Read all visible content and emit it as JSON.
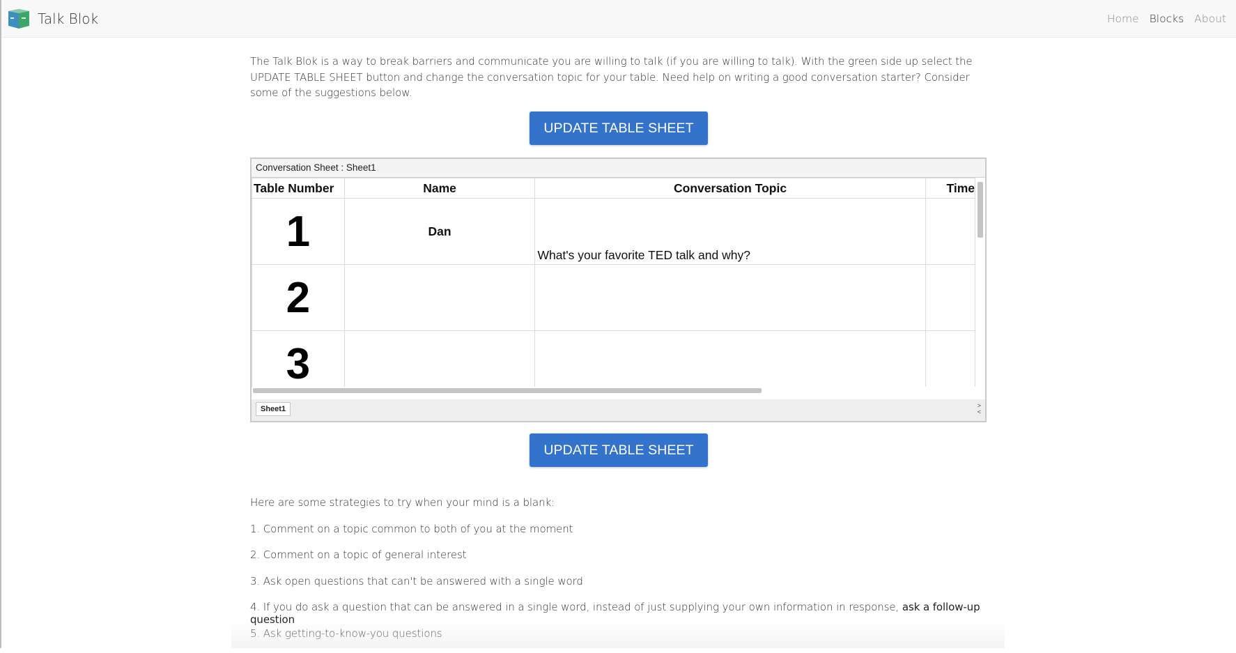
{
  "navbar": {
    "brand": "Talk Blok",
    "links": [
      {
        "label": "Home"
      },
      {
        "label": "Blocks"
      },
      {
        "label": "About"
      }
    ]
  },
  "intro": "The Talk Blok is a way to break barriers and communicate you are willing to talk (if you are willing to talk). With the green side up select the UPDATE TABLE SHEET button and change the conversation topic for your table. Need help on writing a good conversation starter? Consider some of the suggestions below.",
  "buttons": {
    "update_top": "UPDATE TABLE SHEET",
    "update_bottom": "UPDATE TABLE SHEET"
  },
  "sheet": {
    "title": "Conversation Sheet : Sheet1",
    "headers": [
      "Table Number",
      "Name",
      "Conversation Topic",
      "Time"
    ],
    "rows": [
      {
        "number": "1",
        "name": "Dan",
        "topic": "What's your favorite TED talk and why?",
        "time": ""
      },
      {
        "number": "2",
        "name": "",
        "topic": "",
        "time": ""
      },
      {
        "number": "3",
        "name": "",
        "topic": "",
        "time": ""
      }
    ],
    "tab": "Sheet1",
    "tab_arrows": ">\n<"
  },
  "strategies": {
    "heading": "Here are some strategies to try when your mind is a blank:",
    "items": [
      "1. Comment on a topic common to both of you at the moment",
      "2. Comment on a topic of general interest",
      "3. Ask open questions that can't be answered with a single word",
      "4. If you do ask a question that can be answered in a single word, instead of just supplying your own information in response,",
      "5. Ask getting-to-know-you questions"
    ],
    "item4_link": "ask a follow-up question"
  },
  "colors": {
    "button": "#3373cb",
    "navbar": "#f8f8f8",
    "logo_blue": "#2f7fb0",
    "logo_green": "#3ea66a"
  }
}
